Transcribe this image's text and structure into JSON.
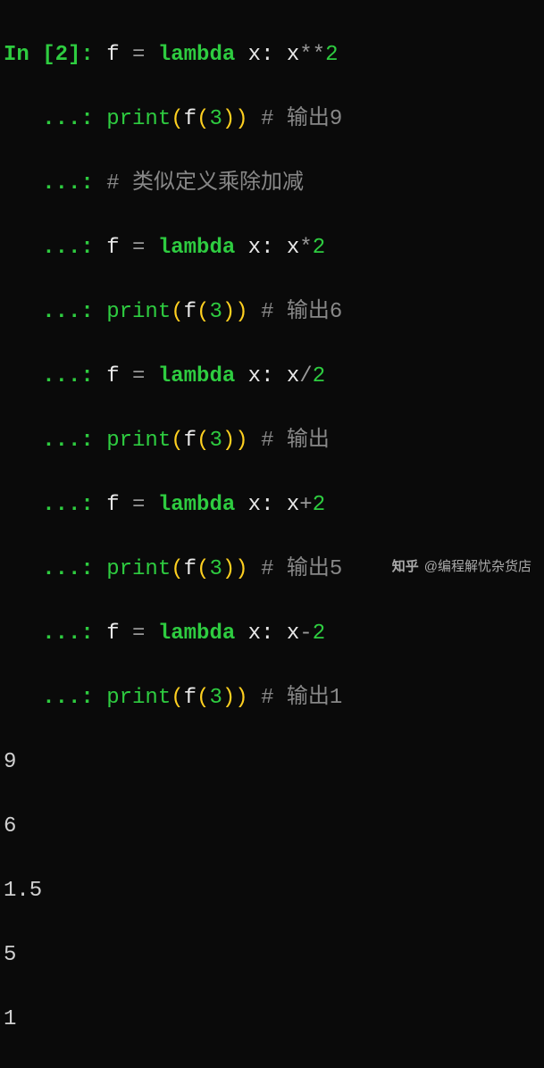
{
  "prompt": {
    "in": "In [2]: ",
    "cont": "   ...: "
  },
  "code": {
    "l1": {
      "a": "f ",
      "b": "= ",
      "c": "lambda",
      "d": " x: x",
      "e": "**",
      "f": "2"
    },
    "l2": {
      "a": "print",
      "b": "(",
      "c": "f",
      "d": "(",
      "e": "3",
      "f": "))",
      "g": " # 输出9"
    },
    "l3": {
      "a": "# 类似定义乘除加减"
    },
    "l4": {
      "a": "f ",
      "b": "= ",
      "c": "lambda",
      "d": " x: x",
      "e": "*",
      "f": "2"
    },
    "l5": {
      "a": "print",
      "b": "(",
      "c": "f",
      "d": "(",
      "e": "3",
      "f": "))",
      "g": " # 输出6"
    },
    "l6": {
      "a": "f ",
      "b": "= ",
      "c": "lambda",
      "d": " x: x",
      "e": "/",
      "f": "2"
    },
    "l7": {
      "a": "print",
      "b": "(",
      "c": "f",
      "d": "(",
      "e": "3",
      "f": "))",
      "g": " # 输出"
    },
    "l8": {
      "a": "f ",
      "b": "= ",
      "c": "lambda",
      "d": " x: x",
      "e": "+",
      "f": "2"
    },
    "l9": {
      "a": "print",
      "b": "(",
      "c": "f",
      "d": "(",
      "e": "3",
      "f": "))",
      "g": " # 输出5"
    },
    "l10": {
      "a": "f ",
      "b": "= ",
      "c": "lambda",
      "d": " x: x",
      "e": "-",
      "f": "2"
    },
    "l11": {
      "a": "print",
      "b": "(",
      "c": "f",
      "d": "(",
      "e": "3",
      "f": "))",
      "g": " # 输出1"
    }
  },
  "output": [
    "9",
    "6",
    "1.5",
    "5",
    "1"
  ],
  "watermark": {
    "logo": "知乎",
    "text": "@编程解忧杂货店"
  }
}
